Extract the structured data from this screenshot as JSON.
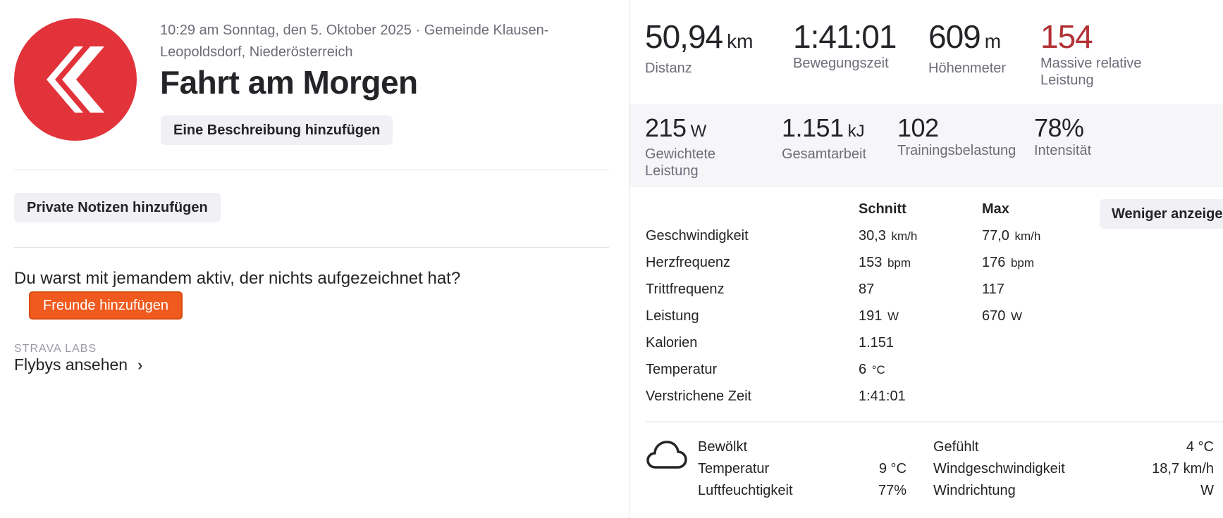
{
  "activity": {
    "meta": "10:29 am Sonntag, den 5. Oktober 2025 · Gemeinde Klausen-Leopoldsdorf, Niederösterreich",
    "title": "Fahrt am Morgen",
    "add_description_label": "Eine Beschreibung hinzufügen",
    "private_notes_label": "Private Notizen hinzufügen",
    "friends_prompt": "Du warst mit jemandem aktiv, der nichts aufgezeichnet hat?",
    "add_friends_label": "Freunde hinzufügen",
    "labs_label": "STRAVA LABS",
    "flybys_label": "Flybys ansehen"
  },
  "colors": {
    "avatar_bg": "#e2333a",
    "accent_orange": "#f05a1e",
    "relative_effort_red": "#b23236"
  },
  "primary_stats": [
    {
      "value": "50,94",
      "unit": "km",
      "label": "Distanz"
    },
    {
      "value": "1:41:01",
      "unit": "",
      "label": "Bewegungszeit"
    },
    {
      "value": "609",
      "unit": "m",
      "label": "Höhenmeter"
    },
    {
      "value": "154",
      "unit": "",
      "label": "Massive relative Leistung"
    }
  ],
  "secondary_stats": [
    {
      "value": "215",
      "unit": "W",
      "label": "Gewichtete Leistung"
    },
    {
      "value": "1.151",
      "unit": "kJ",
      "label": "Gesamtarbeit"
    },
    {
      "value": "102",
      "unit": "",
      "label": "Trainingsbelastung"
    },
    {
      "value": "78%",
      "unit": "",
      "label": "Intensität"
    }
  ],
  "details": {
    "col_avg": "Schnitt",
    "col_max": "Max",
    "less_label": "Weniger anzeigen",
    "rows": [
      {
        "label": "Geschwindigkeit",
        "avg": "30,3",
        "avg_unit": "km/h",
        "max": "77,0",
        "max_unit": "km/h"
      },
      {
        "label": "Herzfrequenz",
        "avg": "153",
        "avg_unit": "bpm",
        "max": "176",
        "max_unit": "bpm"
      },
      {
        "label": "Trittfrequenz",
        "avg": "87",
        "avg_unit": "",
        "max": "117",
        "max_unit": ""
      },
      {
        "label": "Leistung",
        "avg": "191",
        "avg_unit": "W",
        "max": "670",
        "max_unit": "W"
      },
      {
        "label": "Kalorien",
        "avg": "1.151",
        "avg_unit": "",
        "max": "",
        "max_unit": ""
      },
      {
        "label": "Temperatur",
        "avg": "6",
        "avg_unit": "°C",
        "max": "",
        "max_unit": ""
      },
      {
        "label": "Verstrichene Zeit",
        "avg": "1:41:01",
        "avg_unit": "",
        "max": "",
        "max_unit": ""
      }
    ]
  },
  "weather": {
    "icon": "cloud-icon",
    "condition": "Bewölkt",
    "temp_label": "Temperatur",
    "temp_value": "9 °C",
    "humidity_label": "Luftfeuchtigkeit",
    "humidity_value": "77%",
    "feels_label": "Gefühlt",
    "feels_value": "4 °C",
    "wind_speed_label": "Windgeschwindigkeit",
    "wind_speed_value": "18,7 km/h",
    "wind_dir_label": "Windrichtung",
    "wind_dir_value": "W"
  }
}
